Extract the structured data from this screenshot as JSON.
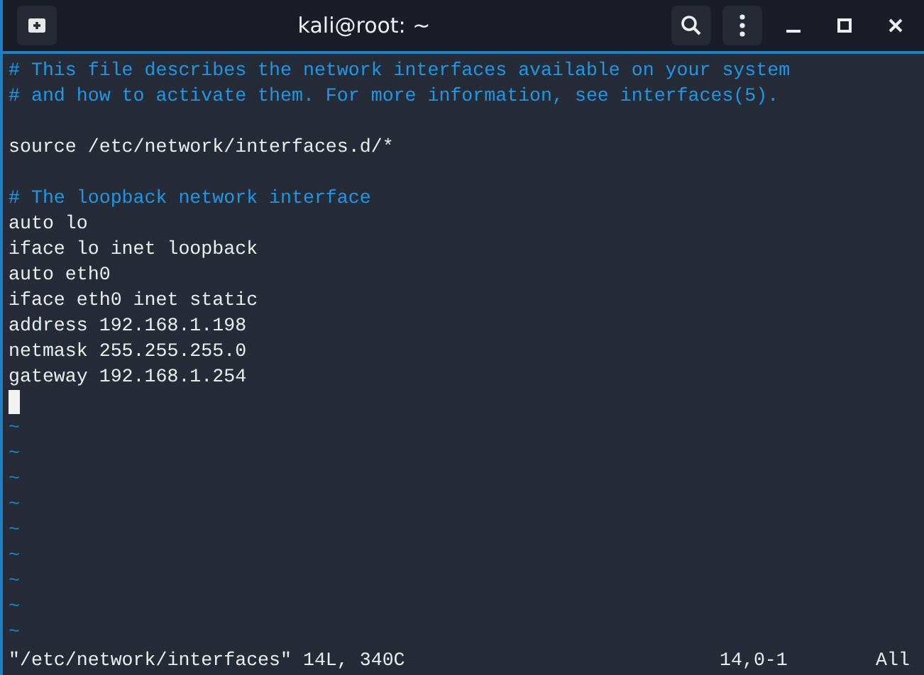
{
  "window": {
    "title": "kali@root: ~"
  },
  "lines": [
    {
      "kind": "comment",
      "text": "# This file describes the network interfaces available on your system"
    },
    {
      "kind": "comment",
      "text": "# and how to activate them. For more information, see interfaces(5)."
    },
    {
      "kind": "blank"
    },
    {
      "kind": "code",
      "text": "source /etc/network/interfaces.d/*"
    },
    {
      "kind": "blank"
    },
    {
      "kind": "comment",
      "text": "# The loopback network interface"
    },
    {
      "kind": "code",
      "text": "auto lo"
    },
    {
      "kind": "code",
      "text": "iface lo inet loopback"
    },
    {
      "kind": "code",
      "text": "auto eth0"
    },
    {
      "kind": "code",
      "text": "iface eth0 inet static"
    },
    {
      "kind": "code",
      "text": "address 192.168.1.198"
    },
    {
      "kind": "code",
      "text": "netmask 255.255.255.0"
    },
    {
      "kind": "code",
      "text": "gateway 192.168.1.254"
    },
    {
      "kind": "cursor"
    },
    {
      "kind": "filler",
      "text": "~"
    },
    {
      "kind": "filler",
      "text": "~"
    },
    {
      "kind": "filler",
      "text": "~"
    },
    {
      "kind": "filler",
      "text": "~"
    },
    {
      "kind": "filler",
      "text": "~"
    },
    {
      "kind": "filler",
      "text": "~"
    },
    {
      "kind": "filler",
      "text": "~"
    },
    {
      "kind": "filler",
      "text": "~"
    },
    {
      "kind": "filler",
      "text": "~"
    }
  ],
  "status_bar": {
    "message": "\"/etc/network/interfaces\" 14L, 340C",
    "position": "14,0-1",
    "scroll": "All"
  }
}
